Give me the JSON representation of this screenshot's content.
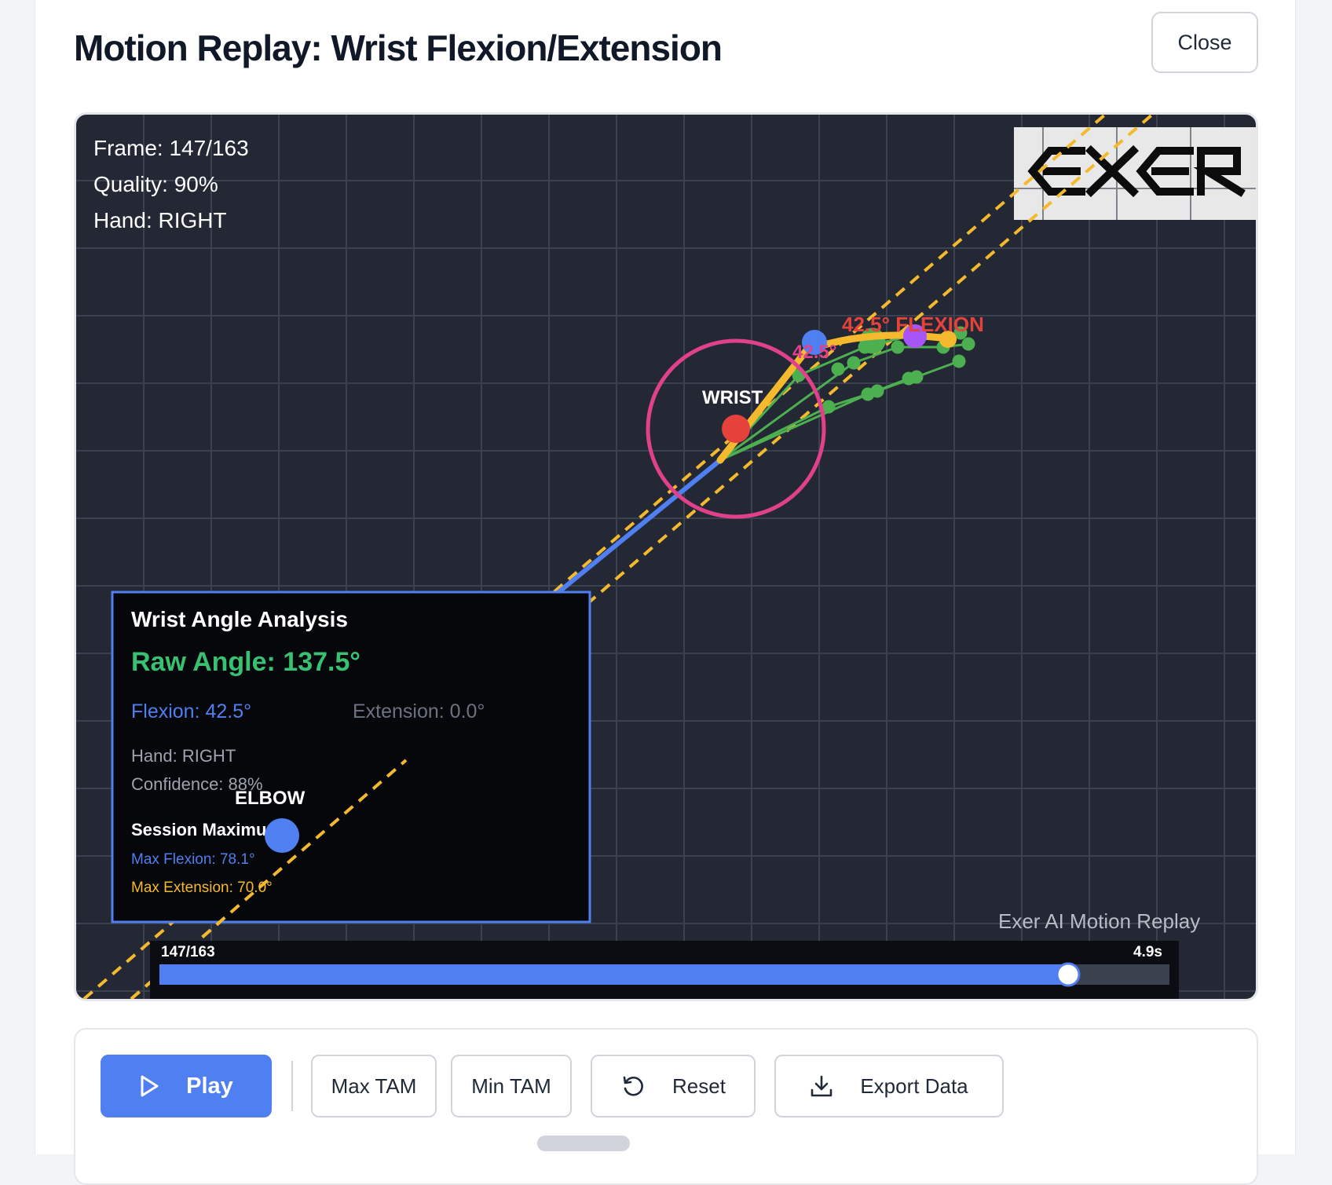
{
  "header": {
    "title": "Motion Replay: Wrist Flexion/Extension",
    "close_label": "Close"
  },
  "overlay": {
    "frame": "Frame: 147/163",
    "quality": "Quality: 90%",
    "hand": "Hand: RIGHT"
  },
  "logo": {
    "text": "EXER"
  },
  "labels": {
    "wrist": "WRIST",
    "elbow": "ELBOW",
    "flexion_tag": "42.5° FLEXION",
    "angle_small": "42.5°"
  },
  "analysis": {
    "title": "Wrist Angle Analysis",
    "raw_angle": "Raw Angle: 137.5°",
    "flexion": "Flexion: 42.5°",
    "extension": "Extension: 0.0°",
    "hand": "Hand: RIGHT",
    "confidence": "Confidence: 88%",
    "session_title": "Session Maximum:",
    "max_flexion": "Max Flexion: 78.1°",
    "max_extension": "Max Extension: 70.0°"
  },
  "timeline": {
    "frame_label": "147/163",
    "time_label": "4.9s",
    "progress": 0.9,
    "watermark": "Exer AI Motion Replay"
  },
  "controls": {
    "play": "Play",
    "max_tam": "Max TAM",
    "min_tam": "Min TAM",
    "reset": "Reset",
    "export": "Export Data"
  },
  "colors": {
    "canvas_bg": "#232834",
    "grid": "#3a4151",
    "accent_blue": "#4f7ff0",
    "reference_line": "#f5b92e",
    "finger_green": "#4caf50",
    "wrist_ring": "#e0418a",
    "wrist_dot": "#e5423b",
    "raw_angle": "#38c172",
    "flexion_tag": "#e5423b"
  },
  "icons": {
    "play": "play-icon",
    "reset": "reset-icon",
    "export": "download-icon"
  }
}
